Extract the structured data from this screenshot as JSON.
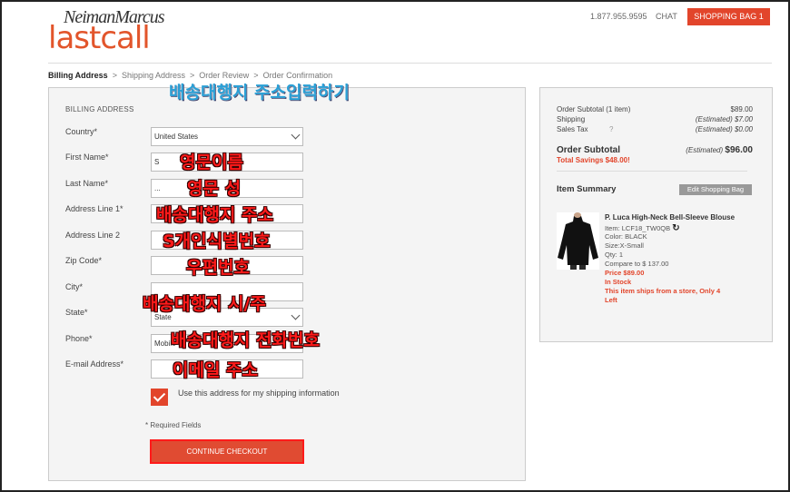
{
  "header": {
    "logo_top": "NeimanMarcus",
    "logo_main": "lastcall",
    "phone": "1.877.955.9595",
    "chat": "CHAT",
    "bag_button": "SHOPPING BAG 1"
  },
  "breadcrumb": [
    "Billing Address",
    "Shipping Address",
    "Order Review",
    "Order Confirmation"
  ],
  "form": {
    "section_title": "BILLING ADDRESS",
    "fields": [
      {
        "label": "Country*",
        "value": "United States"
      },
      {
        "label": "First Name*",
        "value": "S"
      },
      {
        "label": "Last Name*",
        "value": "..."
      },
      {
        "label": "Address Line 1*",
        "value": ""
      },
      {
        "label": "Address Line 2",
        "value": ""
      },
      {
        "label": "Zip Code*",
        "value": ""
      },
      {
        "label": "City*",
        "value": ""
      },
      {
        "label": "State*",
        "value": "State"
      },
      {
        "label": "Phone*",
        "value": "Mobile"
      },
      {
        "label": "E-mail Address*",
        "value": ""
      }
    ],
    "checkbox_label": "Use this address for my shipping information",
    "checkbox_checked": true,
    "required_note": "* Required Fields",
    "continue_button": "CONTINUE CHECKOUT"
  },
  "summary": {
    "rows": [
      {
        "label": "Order Subtotal (1 item)",
        "value": "$89.00"
      },
      {
        "label": "Shipping",
        "value": "(Estimated) $7.00"
      },
      {
        "label": "Sales Tax",
        "help": "?",
        "value": "(Estimated) $0.00"
      }
    ],
    "total_label": "Order Subtotal",
    "total_prefix": "(Estimated)",
    "total_value": "$96.00",
    "savings": "Total Savings $48.00!",
    "item_summary": "Item Summary",
    "edit_button": "Edit Shopping Bag"
  },
  "product": {
    "title": "P. Luca High-Neck Bell-Sleeve Blouse",
    "item": "Item: LCF18_TW0QB",
    "color": "Color: BLACK",
    "size": "Size:X-Small",
    "qty": "Qty: 1",
    "compare": "Compare to $ 137.00",
    "price": "Price $89.00",
    "stock": "In Stock",
    "ships_line1": "This item ships from a store, Only 4",
    "ships_line2": "Left"
  },
  "annotations": {
    "title": "배송대행지 주소입력하기",
    "first_name": "영문이름",
    "last_name": "영문 성",
    "address1": "배송대행지 주소",
    "address2": "S개인식별번호",
    "zip": "우편번호",
    "city_state": "배송대행지 시/주",
    "phone": "배송대행지 전화번호",
    "email": "이메일 주소"
  },
  "colors": {
    "accent": "#e2452b",
    "annotation_red": "#ff1a1a",
    "annotation_blue": "#2aa0d6"
  }
}
